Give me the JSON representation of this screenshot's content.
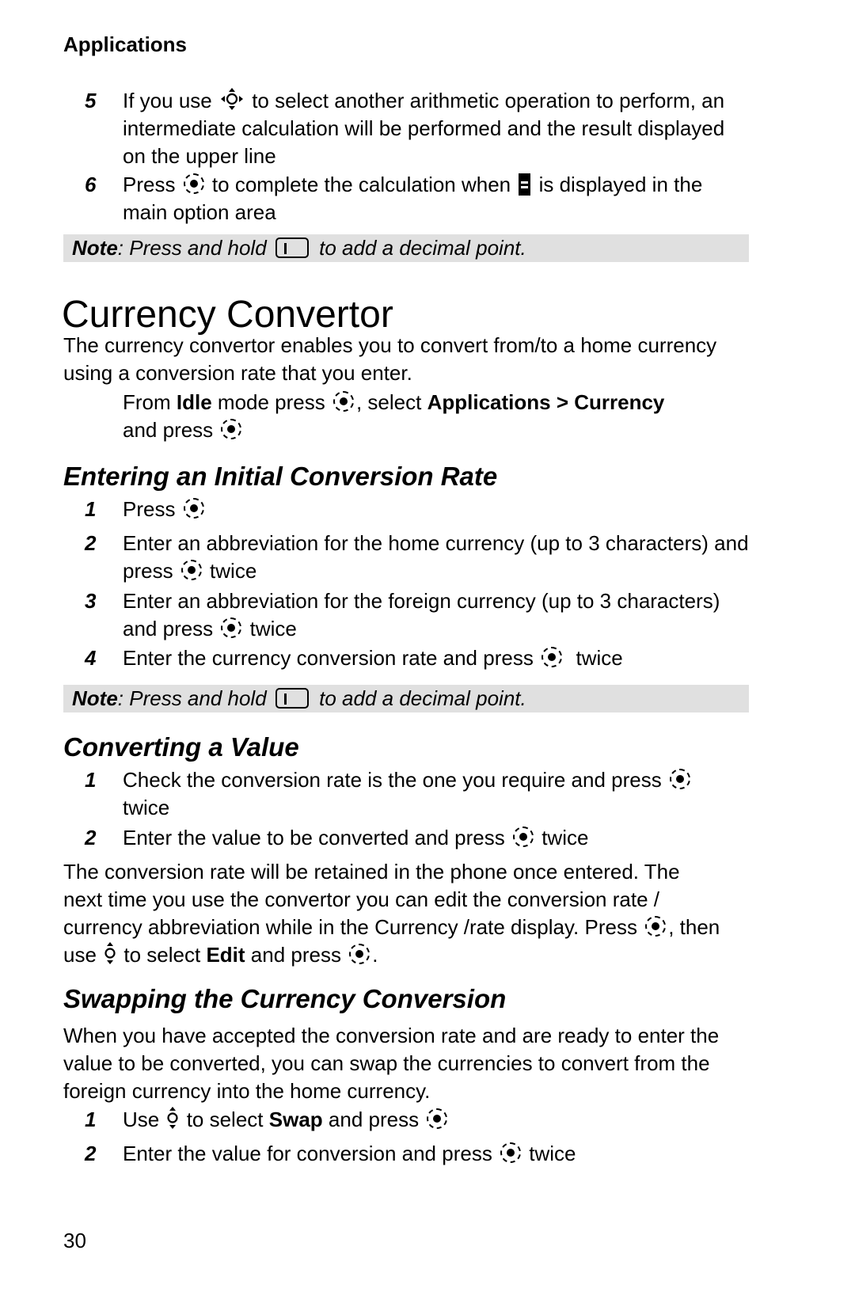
{
  "running_head": "Applications",
  "page_number": "30",
  "top_steps": [
    {
      "num": "5",
      "before": "If you use ",
      "icon": "four-way-nav-key-icon",
      "after": " to select another arithmetic operation to perform, an intermediate calculation will be performed and the result displayed on the upper line"
    },
    {
      "num": "6",
      "before": "Press ",
      "icon": "select-key-icon",
      "mid": " to complete the calculation when ",
      "icon2": "equals-icon",
      "after": " is displayed in the main option area"
    }
  ],
  "note": {
    "label": "Note",
    "before": ": Press and hold ",
    "icon": "key-1-icon",
    "after": " to add a decimal point."
  },
  "title": "Currency Convertor",
  "intro": "The currency convertor enables you to convert from/to a home currency using a conversion rate that you enter.",
  "access": {
    "t1": "From ",
    "b1": "Idle",
    "t2": " mode press ",
    "t3": ", select ",
    "b2": "Applications > Currency",
    "t4": " and press "
  },
  "section_initial": {
    "heading": "Entering an Initial Conversion Rate",
    "steps": [
      {
        "num": "1",
        "before": "Press ",
        "after": ""
      },
      {
        "num": "2",
        "before": "Enter an abbreviation for the home currency (up to 3 characters) and press ",
        "after": " twice"
      },
      {
        "num": "3",
        "before": "Enter an abbreviation for the foreign currency (up to 3 characters) and press ",
        "after": " twice"
      },
      {
        "num": "4",
        "before": "Enter the currency conversion rate and press ",
        "after": "  twice"
      }
    ]
  },
  "section_converting": {
    "heading": "Converting a Value",
    "steps": [
      {
        "num": "1",
        "before": "Check the conversion rate is the one you require and press ",
        "after": " twice"
      },
      {
        "num": "2",
        "before": "Enter the value to be converted and press ",
        "after": " twice"
      }
    ],
    "para": {
      "t1": "The conversion rate will be retained in the phone once entered. The next time you use the convertor you can edit the conversion rate / currency abbreviation while in the Currency /rate display. Press ",
      "t2": ", then use ",
      "t3": " to select ",
      "b1": "Edit",
      "t4": " and press ",
      "t5": "."
    }
  },
  "section_swapping": {
    "heading": "Swapping the Currency Conversion",
    "intro": "When you have accepted the conversion rate and are ready to enter the value to be converted, you can swap the currencies to convert from the foreign currency into the home currency.",
    "steps": [
      {
        "num": "1",
        "t1": "Use ",
        "t2": " to select ",
        "b1": "Swap",
        "t3": " and press "
      },
      {
        "num": "2",
        "before": "Enter the value for conversion and press ",
        "after": " twice"
      }
    ]
  },
  "colors": {
    "note_background": "#e0e0e0",
    "text": "#000000"
  }
}
